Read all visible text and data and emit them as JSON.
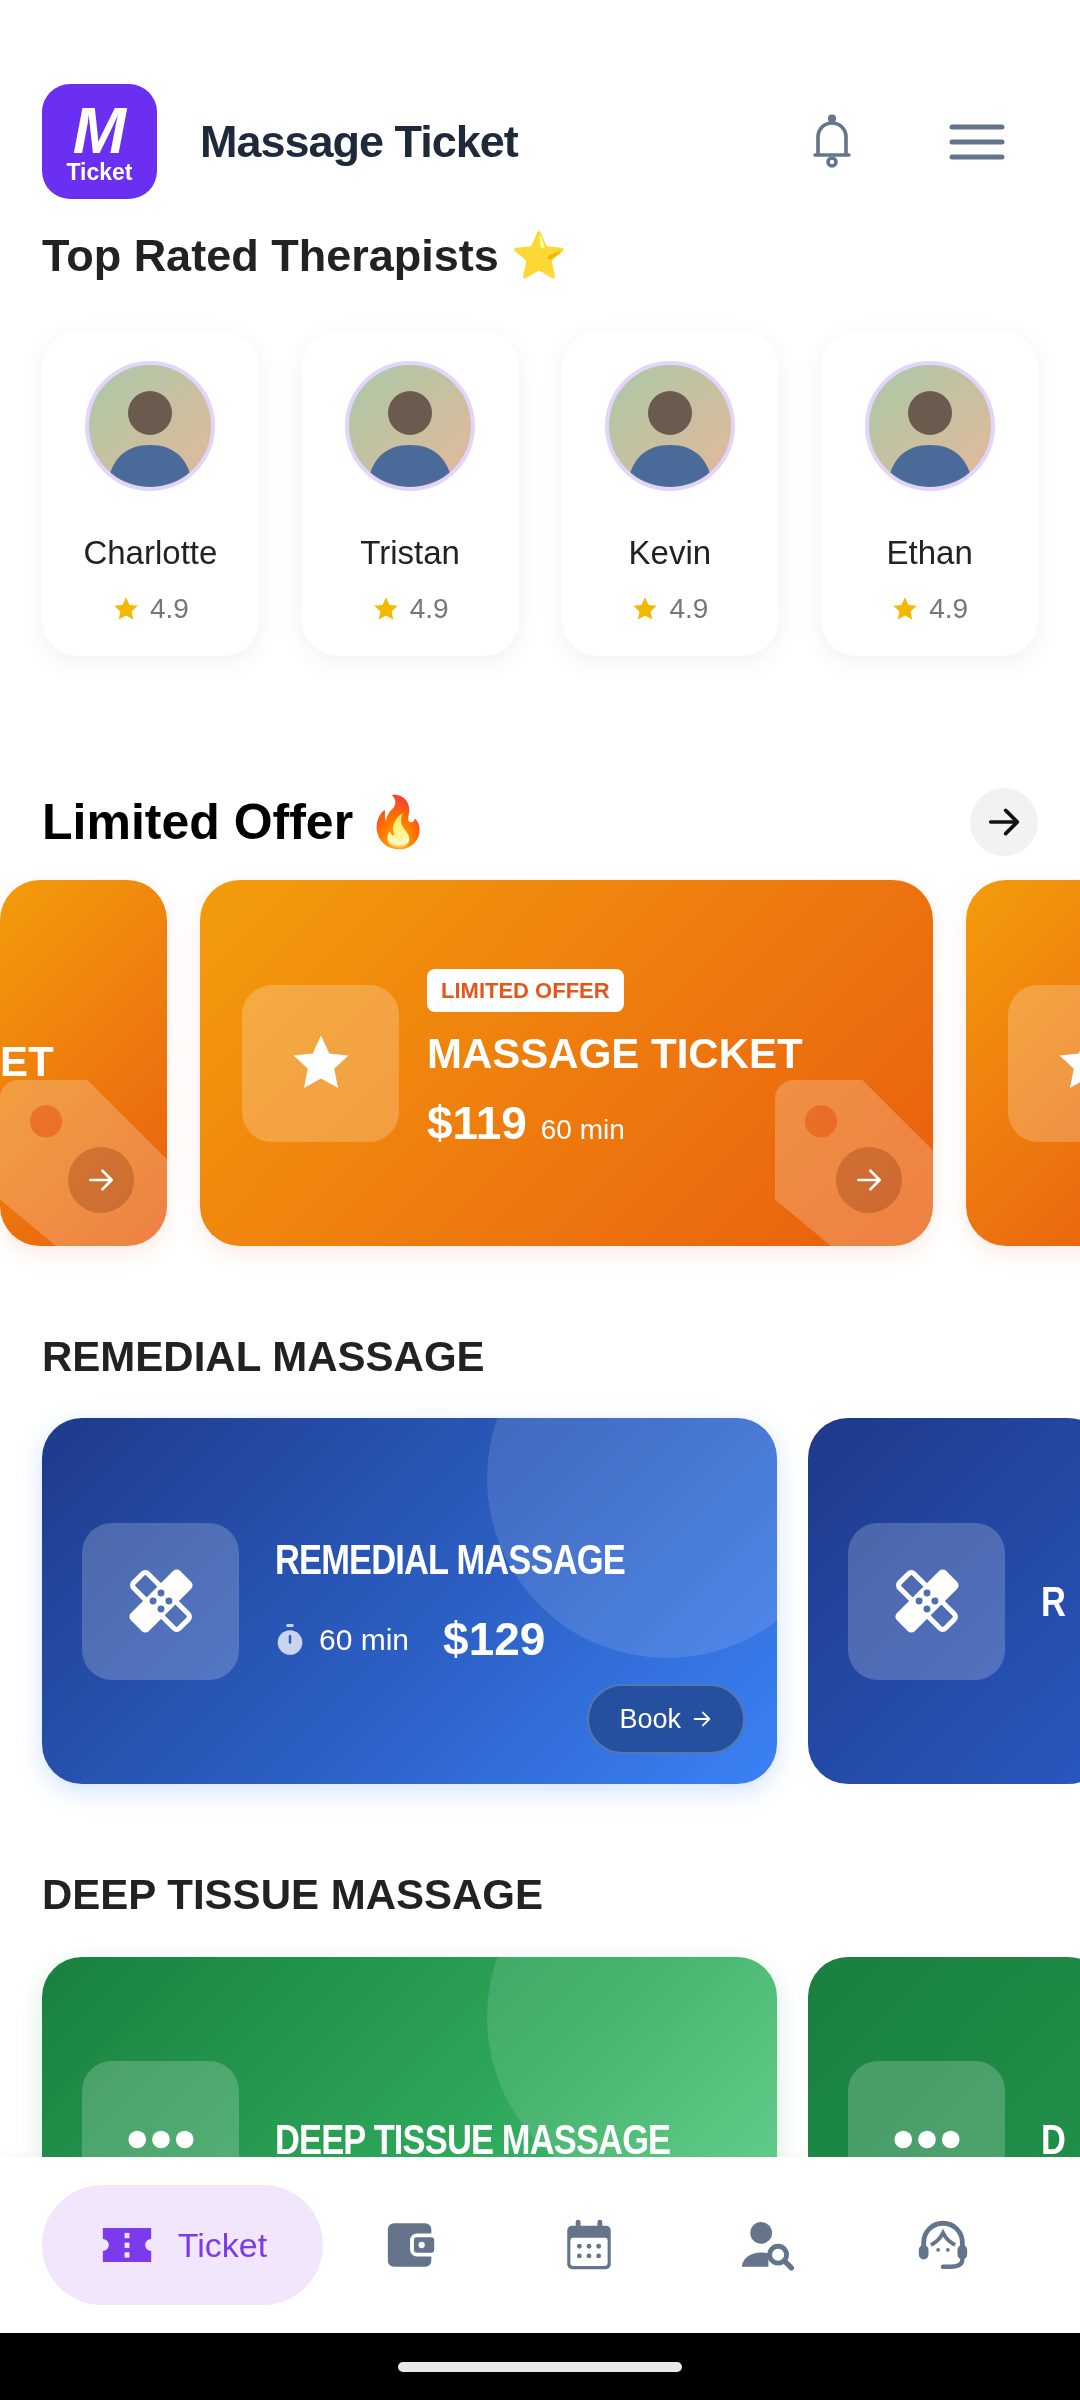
{
  "header": {
    "logo": {
      "letter": "M",
      "word": "Ticket"
    },
    "title": "Massage Ticket"
  },
  "therapists": {
    "title": "Top Rated Therapists ⭐",
    "items": [
      {
        "name": "Charlotte",
        "rating": "4.9"
      },
      {
        "name": "Tristan",
        "rating": "4.9"
      },
      {
        "name": "Kevin",
        "rating": "4.9"
      },
      {
        "name": "Ethan",
        "rating": "4.9"
      }
    ]
  },
  "limited_offer": {
    "title": "Limited Offer 🔥",
    "cards": [
      {
        "kind": "partial_left",
        "title": "ET"
      },
      {
        "kind": "full",
        "badge": "LIMITED OFFER",
        "title": "MASSAGE TICKET",
        "price": "$119",
        "duration": "60 min"
      },
      {
        "kind": "partial_right"
      }
    ]
  },
  "sections": [
    {
      "title": "REMEDIAL MASSAGE",
      "kind": "remedial",
      "cards": [
        {
          "kind": "full",
          "title": "REMEDIAL MASSAGE",
          "duration": "60 min",
          "price": "$129",
          "button": "Book"
        },
        {
          "kind": "partial",
          "title": "R"
        }
      ]
    },
    {
      "title": "DEEP TISSUE MASSAGE",
      "kind": "deep_tissue",
      "cards": [
        {
          "kind": "full",
          "title": "DEEP TISSUE MASSAGE"
        },
        {
          "kind": "partial",
          "title": "D"
        }
      ]
    }
  ],
  "bottom_nav": [
    {
      "label": "Ticket",
      "selected": true
    },
    {
      "selected": false
    },
    {
      "selected": false
    },
    {
      "selected": false
    },
    {
      "selected": false
    }
  ]
}
